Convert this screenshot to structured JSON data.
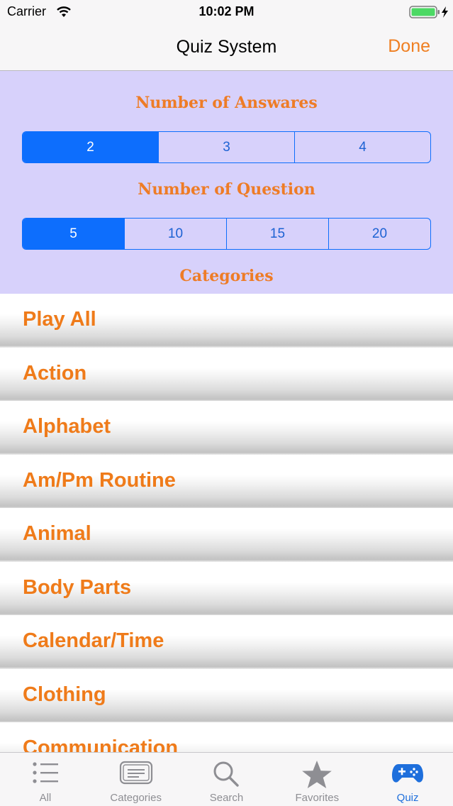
{
  "status_bar": {
    "carrier": "Carrier",
    "time": "10:02 PM"
  },
  "nav": {
    "title": "Quiz System",
    "done_label": "Done"
  },
  "settings": {
    "answers_title": "Number of Answares",
    "answers_options": [
      "2",
      "3",
      "4"
    ],
    "answers_selected": "2",
    "question_title": "Number of Question",
    "question_options": [
      "5",
      "10",
      "15",
      "20"
    ],
    "question_selected": "5",
    "categories_title": "Categories"
  },
  "categories": [
    "Play All",
    "Action",
    "Alphabet",
    "Am/Pm Routine",
    "Animal",
    "Body Parts",
    "Calendar/Time",
    "Clothing",
    "Communication"
  ],
  "tab_bar": {
    "items": [
      {
        "label": "All",
        "icon": "list-icon"
      },
      {
        "label": "Categories",
        "icon": "categories-icon"
      },
      {
        "label": "Search",
        "icon": "search-icon"
      },
      {
        "label": "Favorites",
        "icon": "star-icon"
      },
      {
        "label": "Quiz",
        "icon": "gamepad-icon"
      }
    ],
    "active": "Quiz"
  },
  "colors": {
    "accent_orange": "#ef7b1a",
    "segment_blue": "#0d6efd",
    "panel_bg": "#d7d1fb",
    "tab_active": "#1e6fdc"
  }
}
